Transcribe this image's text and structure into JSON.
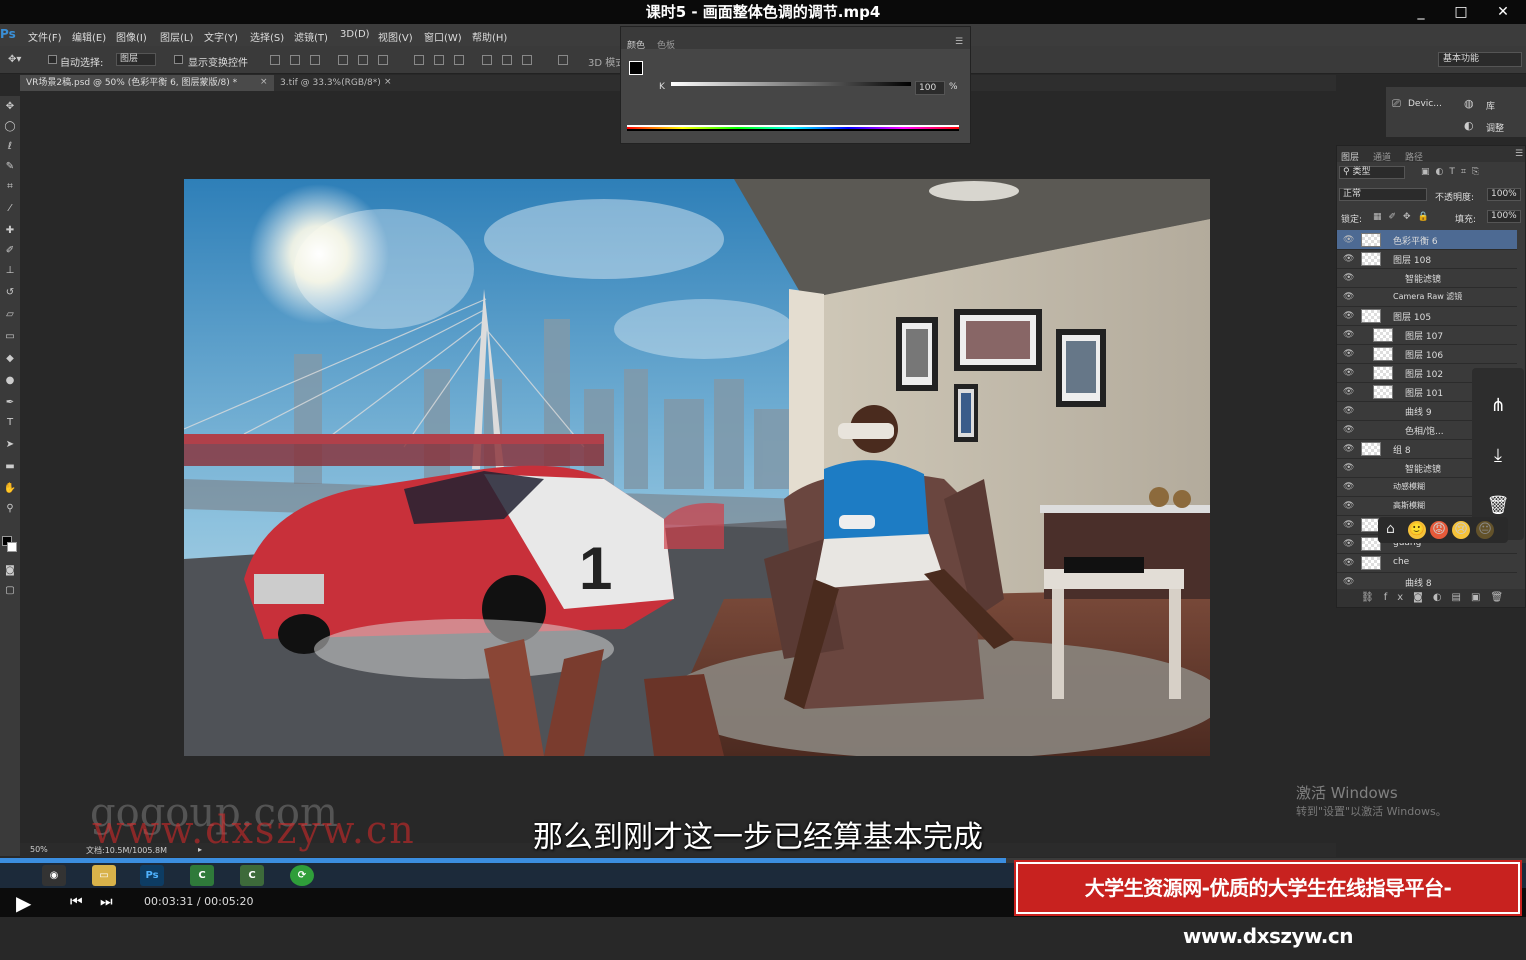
{
  "video": {
    "title": "课时5 - 画面整体色调的调节.mp4",
    "window_controls": [
      "_",
      "□",
      "✕"
    ],
    "current_time": "00:03:31",
    "duration": "00:05:20",
    "progress_fraction": 0.659,
    "subtitle": "那么到刚才这一步已经算基本完成"
  },
  "photoshop": {
    "logo": "Ps",
    "menu": [
      "文件(F)",
      "编辑(E)",
      "图像(I)",
      "图层(L)",
      "文字(Y)",
      "选择(S)",
      "滤镜(T)",
      "3D(D)",
      "视图(V)",
      "窗口(W)",
      "帮助(H)"
    ],
    "options": {
      "auto_select_label": "自动选择:",
      "auto_select_value": "图层",
      "show_transform_label": "显示变换控件",
      "mode_3d_label": "3D 模式:"
    },
    "workspace": "基本功能",
    "doc_tabs": [
      "VR场景2稿.psd @ 50% (色彩平衡 6, 图层蒙版/8) *",
      "3.tif @ 33.3%(RGB/8*)"
    ],
    "status": {
      "zoom": "50%",
      "doc_size": "文档:10.5M/1005.8M"
    },
    "color_panel": {
      "tabs": [
        "颜色",
        "色板"
      ],
      "channel": "K",
      "value": "100",
      "unit": "%"
    },
    "mini_panel": {
      "device": "Devic...",
      "library": "库",
      "adjust": "调整"
    },
    "layers_panel": {
      "tabs": [
        "图层",
        "通道",
        "路径"
      ],
      "filter_kind": "类型",
      "blend_mode": "正常",
      "opacity_label": "不透明度:",
      "opacity": "100%",
      "lock_label": "锁定:",
      "fill_label": "填充:",
      "fill": "100%",
      "layers": [
        {
          "name": "色彩平衡 6",
          "indent": 0
        },
        {
          "name": "图层 108",
          "indent": 0
        },
        {
          "name": "智能滤镜",
          "indent": 1
        },
        {
          "name": "Camera Raw 滤镜",
          "indent": 2
        },
        {
          "name": "图层 105",
          "indent": 0
        },
        {
          "name": "图层 107",
          "indent": 1
        },
        {
          "name": "图层 106",
          "indent": 1
        },
        {
          "name": "图层 102",
          "indent": 1
        },
        {
          "name": "图层 101",
          "indent": 1
        },
        {
          "name": "曲线 9",
          "indent": 1
        },
        {
          "name": "色相/饱...",
          "indent": 1
        },
        {
          "name": "组 8",
          "indent": 0
        },
        {
          "name": "智能滤镜",
          "indent": 1
        },
        {
          "name": "动感模糊",
          "indent": 2
        },
        {
          "name": "高斯模糊",
          "indent": 2
        },
        {
          "name": "",
          "indent": 0
        },
        {
          "name": "guang",
          "indent": 0
        },
        {
          "name": "che",
          "indent": 0
        },
        {
          "name": "曲线 8",
          "indent": 1
        }
      ]
    }
  },
  "overlay": {
    "watermark_gray": "gogoup.com",
    "watermark_red": "www.dxszyw.cn",
    "activate_title": "激活 Windows",
    "activate_sub": "转到\"设置\"以激活 Windows。",
    "banner": "大学生资源网-优质的大学生在线指导平台-www.dxszyw.cn",
    "share_icons": [
      "share-icon",
      "download-icon",
      "delete-icon"
    ],
    "emojis": [
      "🙂",
      "😡",
      "😢",
      "😐"
    ]
  },
  "colors": {
    "accent": "#3b8ee0",
    "banner_red": "#c8221f",
    "layer_selected": "#4d6a93"
  }
}
